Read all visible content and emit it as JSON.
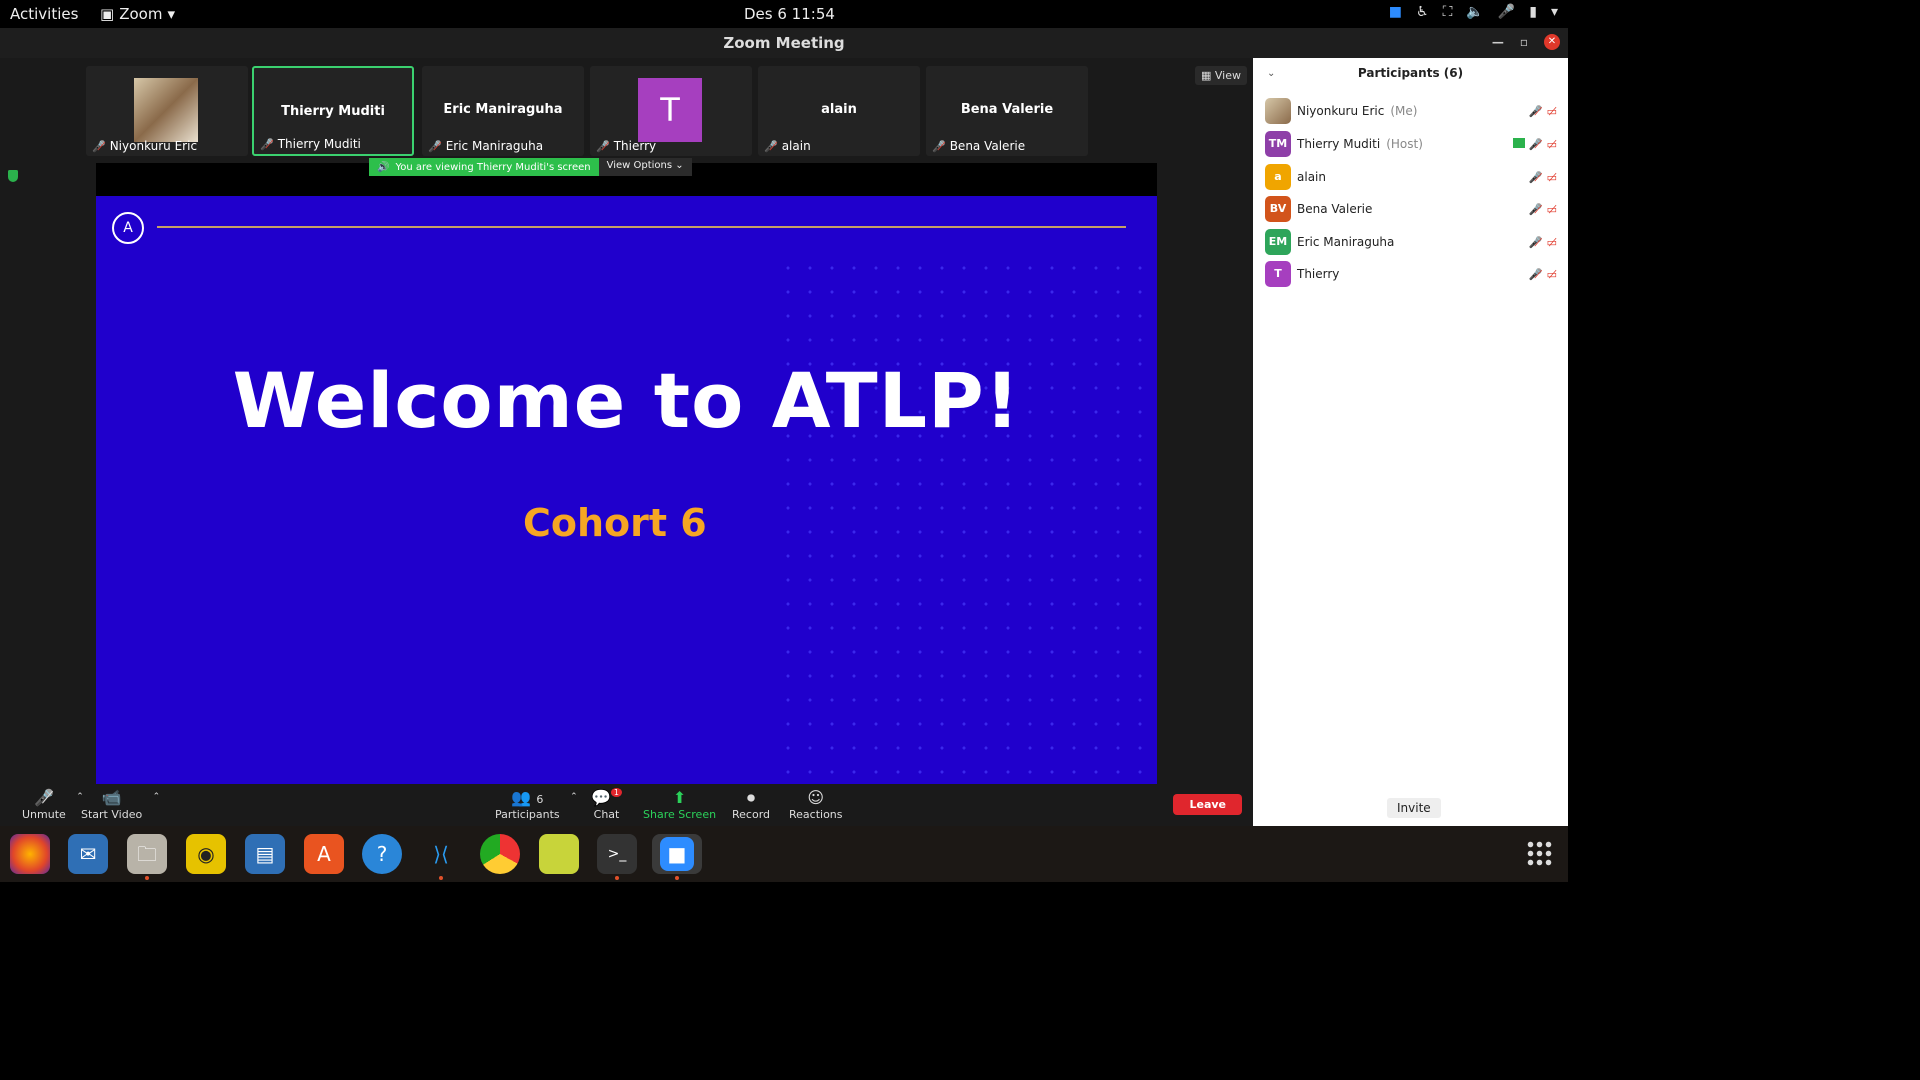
{
  "topbar": {
    "activities": "Activities",
    "app_name": "Zoom",
    "clock": "Des 6  11:54"
  },
  "window": {
    "title": "Zoom Meeting"
  },
  "thumbnails": [
    {
      "big": "",
      "label": "Niyonkuru Eric"
    },
    {
      "big": "Thierry Muditi",
      "label": "Thierry Muditi"
    },
    {
      "big": "Eric Maniraguha",
      "label": "Eric Maniraguha"
    },
    {
      "big": "T",
      "label": "Thierry"
    },
    {
      "big": "alain",
      "label": "alain"
    },
    {
      "big": "Bena Valerie",
      "label": "Bena Valerie"
    }
  ],
  "view_button": "View",
  "banner": {
    "message": "You are viewing Thierry Muditi's screen",
    "options": "View Options"
  },
  "slide": {
    "logo": "A",
    "headline": "Welcome to ATLP!",
    "subtitle": "Cohort 6",
    "colors": {
      "background": "#2000cc",
      "accent": "#f6a623"
    }
  },
  "controls": {
    "unmute": "Unmute",
    "start_video": "Start Video",
    "participants": "Participants",
    "participants_count": "6",
    "chat": "Chat",
    "chat_badge": "1",
    "share_screen": "Share Screen",
    "record": "Record",
    "reactions": "Reactions",
    "leave": "Leave"
  },
  "panel": {
    "title": "Participants (6)",
    "participants": [
      {
        "initials": "",
        "name": "Niyonkuru Eric",
        "tag": "(Me)",
        "color": "#c9a886"
      },
      {
        "initials": "TM",
        "name": "Thierry Muditi",
        "tag": "(Host)",
        "color": "#8e3fa8"
      },
      {
        "initials": "a",
        "name": "alain",
        "tag": "",
        "color": "#f0a500"
      },
      {
        "initials": "BV",
        "name": "Bena Valerie",
        "tag": "",
        "color": "#d2541b"
      },
      {
        "initials": "EM",
        "name": "Eric Maniraguha",
        "tag": "",
        "color": "#2ea55a"
      },
      {
        "initials": "T",
        "name": "Thierry",
        "tag": "",
        "color": "#a63fbf"
      }
    ],
    "invite": "Invite"
  }
}
